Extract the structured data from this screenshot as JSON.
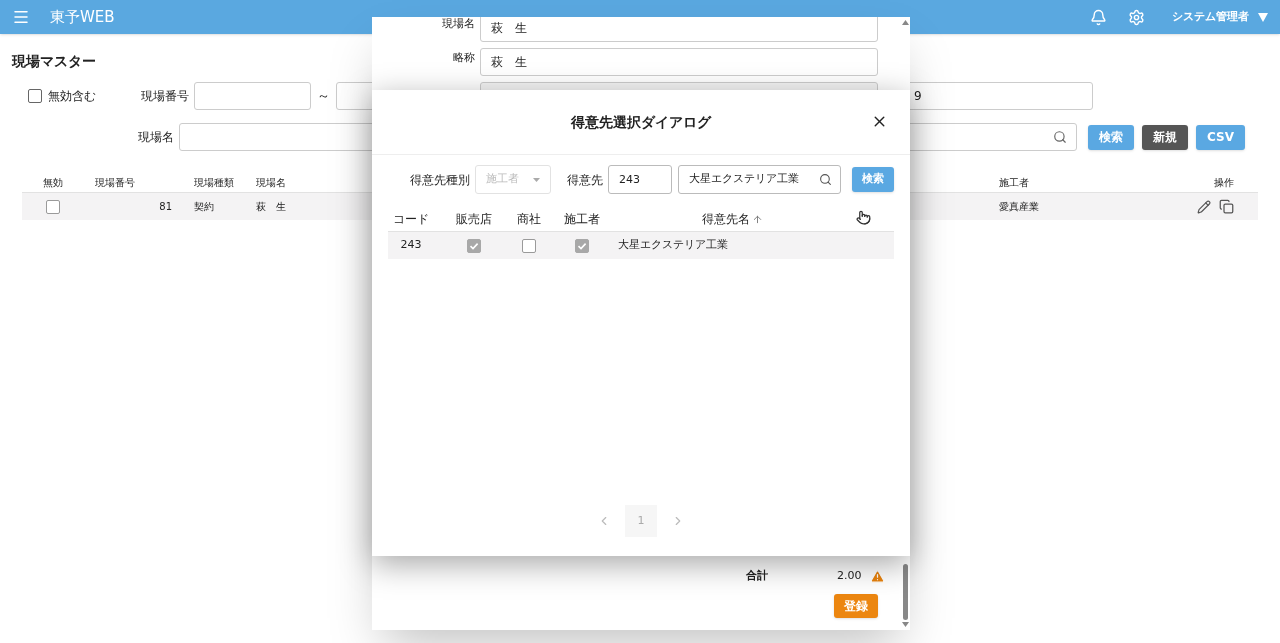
{
  "header": {
    "title": "東予WEB",
    "user": "システム管理者"
  },
  "page": {
    "title": "現場マスター",
    "filters": {
      "include_invalid": {
        "label": "無効含む",
        "checked": false
      },
      "site_number": {
        "label": "現場番号",
        "separator": "～"
      },
      "field_3": {
        "value": "9"
      },
      "site_name": {
        "label": "現場名"
      }
    },
    "buttons": [
      {
        "label": "検索",
        "kind": "primary"
      },
      {
        "label": "新規",
        "kind": "dark"
      },
      {
        "label": "CSV",
        "kind": "primary"
      }
    ]
  },
  "table": {
    "columns": [
      "無効",
      "現場番号",
      "現場種類",
      "現場名",
      "施工者",
      "操作"
    ],
    "rows": [
      {
        "invalid": false,
        "number": "81",
        "type": "契約",
        "name": "萩　生",
        "contractor": "愛真産業"
      }
    ]
  },
  "edit_form": {
    "fields": [
      {
        "kind": "text",
        "label": "現場名",
        "value": "萩　生"
      },
      {
        "kind": "text",
        "label": "略称",
        "value": "萩　生"
      },
      {
        "kind": "readonly"
      }
    ],
    "total_label": "合計",
    "total": "2.00",
    "warning": true,
    "submit": "登録"
  },
  "dialog": {
    "title": "得意先選択ダイアログ",
    "filters": {
      "type_label": "得意先種別",
      "type_value": "施工者",
      "type_disabled": true,
      "customer_label": "得意先",
      "code": "243",
      "name": "大星エクステリア工業"
    },
    "search_button": "検索",
    "columns": [
      {
        "label": "コード"
      },
      {
        "label": "販売店"
      },
      {
        "label": "商社"
      },
      {
        "label": "施工者"
      },
      {
        "label": "得意先名",
        "sorted": true
      }
    ],
    "rows": [
      {
        "code": "243",
        "dealer": true,
        "trading": false,
        "contractor": true,
        "name": "大星エクステリア工業"
      }
    ],
    "pages": [
      {
        "label": "1",
        "selected": true
      }
    ]
  }
}
